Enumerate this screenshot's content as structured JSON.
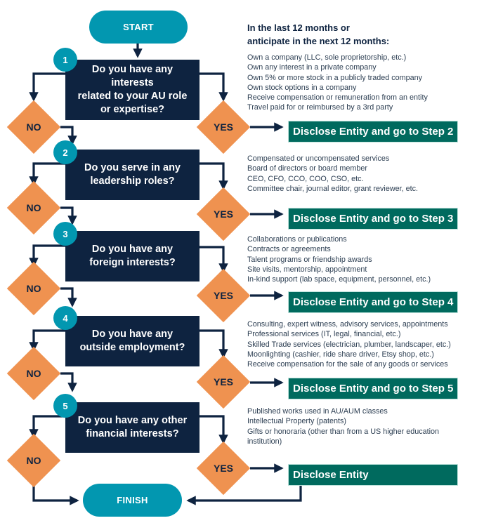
{
  "colors": {
    "terminal": "#0297b0",
    "question_box": "#0e2340",
    "decision": "#ef9250",
    "disclose_box": "#006a5e",
    "connector": "#0e2340"
  },
  "start": {
    "label": "START"
  },
  "finish": {
    "label": "FINISH"
  },
  "header": {
    "line1": "In the last 12 months or",
    "line2": "anticipate in the next 12 months:"
  },
  "steps": [
    {
      "number": "1",
      "question_lines": [
        "Do you have any interests",
        "related to your AU role",
        "or expertise?"
      ],
      "no_label": "NO",
      "yes_label": "YES",
      "disclose_label": "Disclose Entity and go to Step 2",
      "examples": [
        "Own a company (LLC, sole proprietorship, etc.)",
        "Own any interest in a private company",
        "Own 5% or more stock in a publicly traded company",
        "Own stock options in a company",
        "Receive compensation or remuneration from an entity",
        "Travel paid for or reimbursed by a 3rd party"
      ]
    },
    {
      "number": "2",
      "question_lines": [
        "Do you serve in any",
        "leadership roles?"
      ],
      "no_label": "NO",
      "yes_label": "YES",
      "disclose_label": "Disclose Entity and go to Step 3",
      "examples": [
        "Compensated or uncompensated services",
        "Board of directors or board member",
        "CEO, CFO, CCO, COO, CSO, etc.",
        "Committee chair, journal editor, grant reviewer, etc."
      ]
    },
    {
      "number": "3",
      "question_lines": [
        "Do you have any",
        "foreign interests?"
      ],
      "no_label": "NO",
      "yes_label": "YES",
      "disclose_label": "Disclose Entity and go to Step 4",
      "examples": [
        "Collaborations or publications",
        "Contracts or agreements",
        "Talent programs or friendship awards",
        "Site visits, mentorship, appointment",
        "In-kind support (lab space, equipment, personnel, etc.)"
      ]
    },
    {
      "number": "4",
      "question_lines": [
        "Do you have any",
        "outside employment?"
      ],
      "no_label": "NO",
      "yes_label": "YES",
      "disclose_label": "Disclose Entity and go to Step 5",
      "examples": [
        "Consulting, expert witness, advisory services, appointments",
        "Professional services (IT, legal, financial, etc.)",
        "Skilled Trade services (electrician, plumber, landscaper, etc.)",
        "Moonlighting (cashier, ride share driver, Etsy shop, etc.)",
        "Receive compensation for the sale of any goods or services"
      ]
    },
    {
      "number": "5",
      "question_lines": [
        "Do you have any other",
        "financial interests?"
      ],
      "no_label": "NO",
      "yes_label": "YES",
      "disclose_label": "Disclose Entity",
      "examples": [
        "Published works used in AU/AUM classes",
        "Intellectual Property (patents)",
        "Gifts or honoraria (other than from a US higher education",
        "institution)"
      ]
    }
  ]
}
